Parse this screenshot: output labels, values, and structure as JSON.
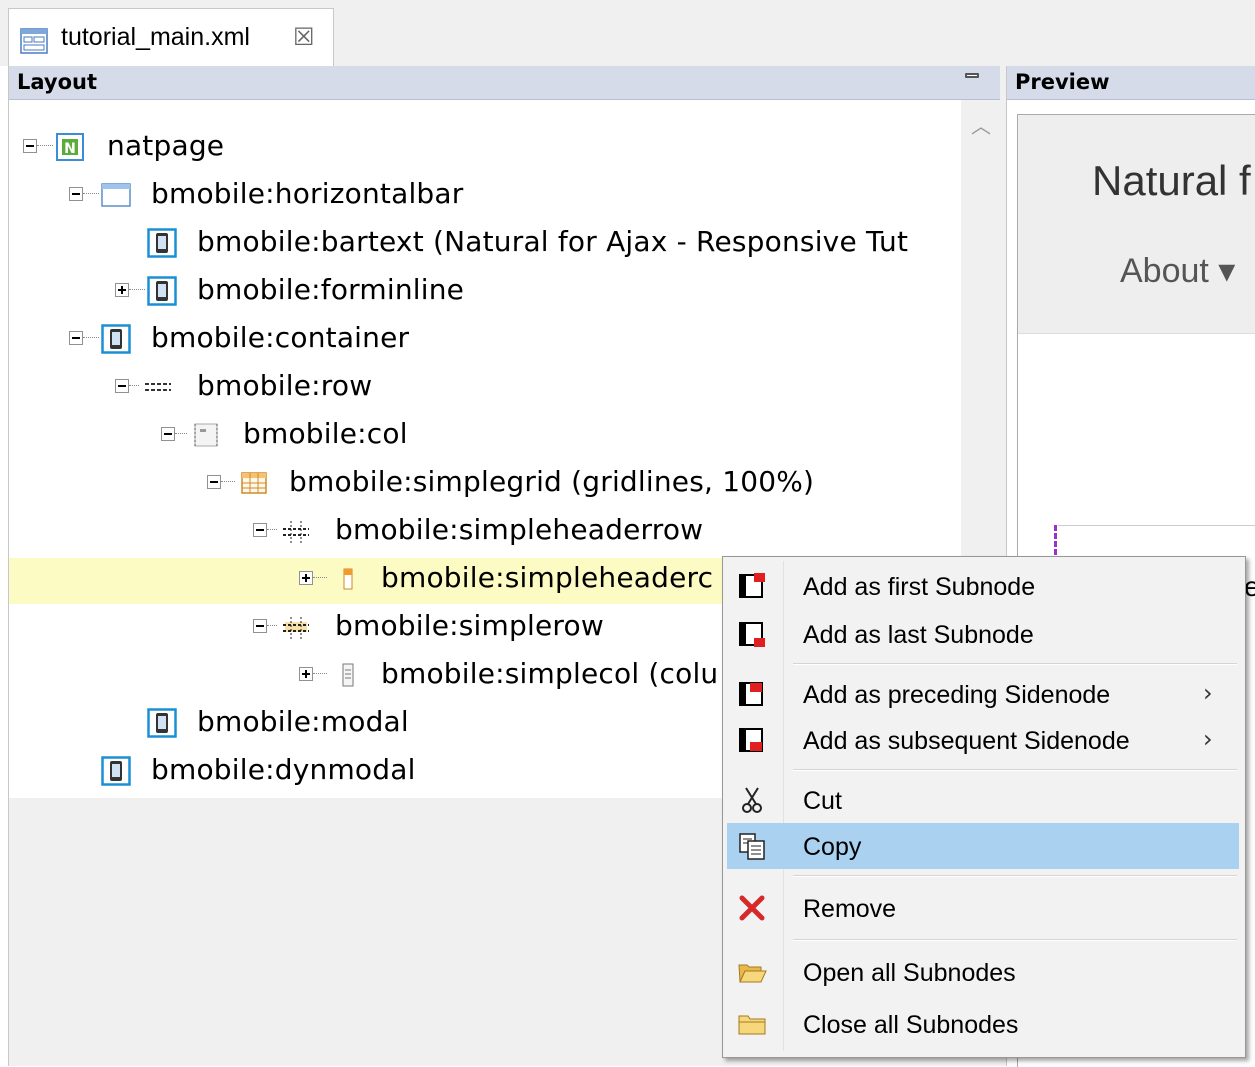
{
  "editor_tab": {
    "label": "tutorial_main.xml",
    "close_glyph": "☒"
  },
  "layout_panel": {
    "title": "Layout"
  },
  "preview_panel": {
    "title": "Preview",
    "brand_text": "Natural f",
    "nav_item": "About ▾",
    "partial_text": "e"
  },
  "tree": {
    "rows": [
      {
        "label": "natpage",
        "icon": "natpage-icon"
      },
      {
        "label": "bmobile:horizontalbar",
        "icon": "horizontalbar-icon"
      },
      {
        "label": "bmobile:bartext (Natural for Ajax - Responsive Tut",
        "icon": "mobile-control-icon"
      },
      {
        "label": "bmobile:forminline",
        "icon": "mobile-control-icon"
      },
      {
        "label": "bmobile:container",
        "icon": "mobile-control-icon"
      },
      {
        "label": "bmobile:row",
        "icon": "row-icon"
      },
      {
        "label": "bmobile:col",
        "icon": "col-icon"
      },
      {
        "label": "bmobile:simplegrid (gridlines, 100%)",
        "icon": "grid-icon"
      },
      {
        "label": "bmobile:simpleheaderrow",
        "icon": "headerrow-icon"
      },
      {
        "label": "bmobile:simpleheaderc",
        "icon": "headercell-icon"
      },
      {
        "label": "bmobile:simplerow",
        "icon": "simplerow-icon"
      },
      {
        "label": "bmobile:simplecol (colu",
        "icon": "simplecol-icon"
      },
      {
        "label": "bmobile:modal",
        "icon": "mobile-control-icon"
      },
      {
        "label": "bmobile:dynmodal",
        "icon": "mobile-control-icon"
      }
    ]
  },
  "context_menu": {
    "items": [
      {
        "label": "Add as first Subnode",
        "icon": "add-first-subnode-icon"
      },
      {
        "label": "Add as last Subnode",
        "icon": "add-last-subnode-icon"
      },
      {
        "label": "Add as preceding Sidenode",
        "icon": "add-preceding-sidenode-icon",
        "submenu": "›"
      },
      {
        "label": "Add as subsequent Sidenode",
        "icon": "add-subsequent-sidenode-icon",
        "submenu": "›"
      },
      {
        "label": "Cut",
        "icon": "scissors-icon"
      },
      {
        "label": "Copy",
        "icon": "copy-icon",
        "highlighted": true
      },
      {
        "label": "Remove",
        "icon": "red-x-icon"
      },
      {
        "label": "Open all Subnodes",
        "icon": "open-folder-icon"
      },
      {
        "label": "Close all Subnodes",
        "icon": "closed-folder-icon"
      }
    ]
  },
  "colors": {
    "panel_header": "#d6dbe9",
    "selection_row": "#fdfbc4",
    "menu_highlight": "#abd1f1",
    "icon_blue": "#1a8fd6"
  }
}
